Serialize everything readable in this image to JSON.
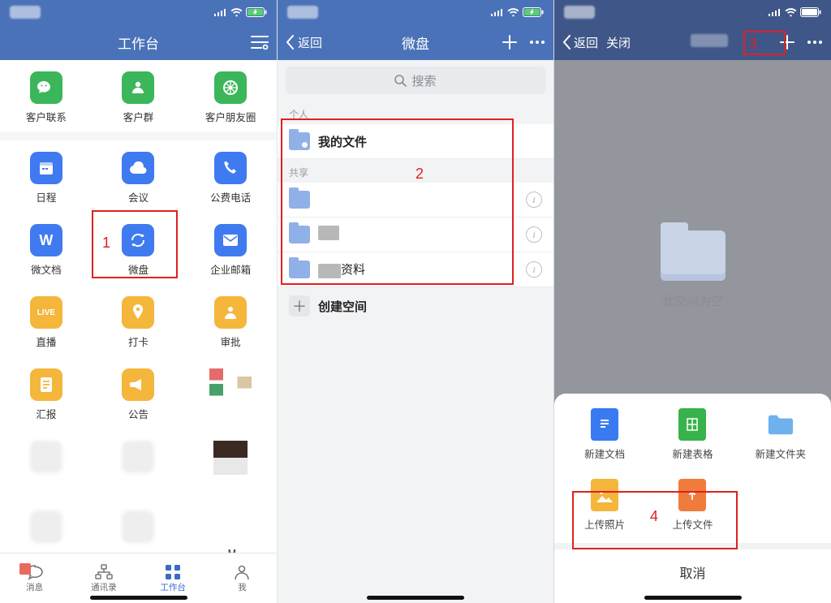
{
  "screen1": {
    "title": "工作台",
    "row1": [
      {
        "icon": "wechat",
        "bg": "#3bb65b",
        "label": "客户联系"
      },
      {
        "icon": "user",
        "bg": "#3bb65b",
        "label": "客户群"
      },
      {
        "icon": "aperture",
        "bg": "#3bb65b",
        "label": "客户朋友圈"
      }
    ],
    "row2": [
      {
        "icon": "calendar",
        "bg": "#3f7af0",
        "label": "日程"
      },
      {
        "icon": "cloud",
        "bg": "#3f7af0",
        "label": "会议"
      },
      {
        "icon": "phone",
        "bg": "#3f7af0",
        "label": "公费电话"
      },
      {
        "icon": "W",
        "bg": "#3f7af0",
        "label": "微文档"
      },
      {
        "icon": "cycle",
        "bg": "#3f7af0",
        "label": "微盘"
      },
      {
        "icon": "mail",
        "bg": "#3f7af0",
        "label": "企业邮箱"
      },
      {
        "icon": "LIVE",
        "bg": "#f4b63b",
        "label": "直播"
      },
      {
        "icon": "pin",
        "bg": "#f4b63b",
        "label": "打卡"
      },
      {
        "icon": "person",
        "bg": "#f4b63b",
        "label": "审批"
      },
      {
        "icon": "report",
        "bg": "#f4b63b",
        "label": "汇报"
      },
      {
        "icon": "horn",
        "bg": "#f4b63b",
        "label": "公告"
      }
    ],
    "grid_ext_dotM": ".M",
    "tabs": [
      "消息",
      "通讯录",
      "工作台",
      "我"
    ],
    "redlabel": "1"
  },
  "screen2": {
    "back": "返回",
    "title": "微盘",
    "search_placeholder": "搜索",
    "section_personal": "个人",
    "my_files": "我的文件",
    "section_shared": "共享",
    "shared_suffix": "资料",
    "create_space": "创建空间",
    "redlabel": "2"
  },
  "screen3": {
    "back": "返回",
    "close": "关闭",
    "empty_text": "此空间为空",
    "redlabel_plus": "3",
    "sheet_items": [
      {
        "label": "新建文档",
        "bg": "#3a7af0",
        "glyph": "doc"
      },
      {
        "label": "新建表格",
        "bg": "#38b24a",
        "glyph": "sheet"
      },
      {
        "label": "新建文件夹",
        "bg": "#6fb1ef",
        "glyph": "folder"
      },
      {
        "label": "上传照片",
        "bg": "#f4b63b",
        "glyph": "image"
      },
      {
        "label": "上传文件",
        "bg": "#f07b3b",
        "glyph": "upload"
      }
    ],
    "redlabel_upload": "4",
    "cancel": "取消"
  }
}
